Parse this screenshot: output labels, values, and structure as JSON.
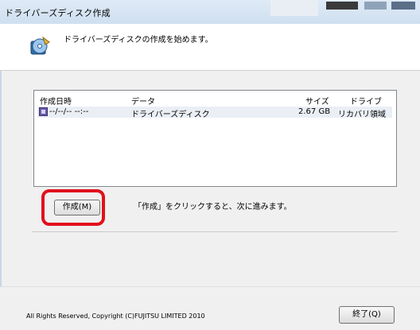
{
  "window": {
    "title": "ドライバーズディスク作成"
  },
  "header": {
    "message": "ドライバーズディスクの作成を始めます。",
    "icon": "disc-wizard-icon"
  },
  "table": {
    "columns": [
      "作成日時",
      "データ",
      "サイズ",
      "ドライブ"
    ],
    "rows": [
      {
        "date": "--/--/-- --:--",
        "data": "ドライバーズディスク",
        "size": "2.67 GB",
        "drive": "リカバリ領域"
      }
    ]
  },
  "actions": {
    "create_label": "作成(M)",
    "hint": "「作成」をクリックすると、次に進みます。",
    "exit_label": "終了(Q)"
  },
  "footer": {
    "copyright": "All Rights Reserved, Copyright (C)FUJITSU LIMITED 2010"
  },
  "colors": {
    "highlight": "#e0101c",
    "selected_row": "#eaeff5",
    "titlebar": "#dfeaf6"
  }
}
